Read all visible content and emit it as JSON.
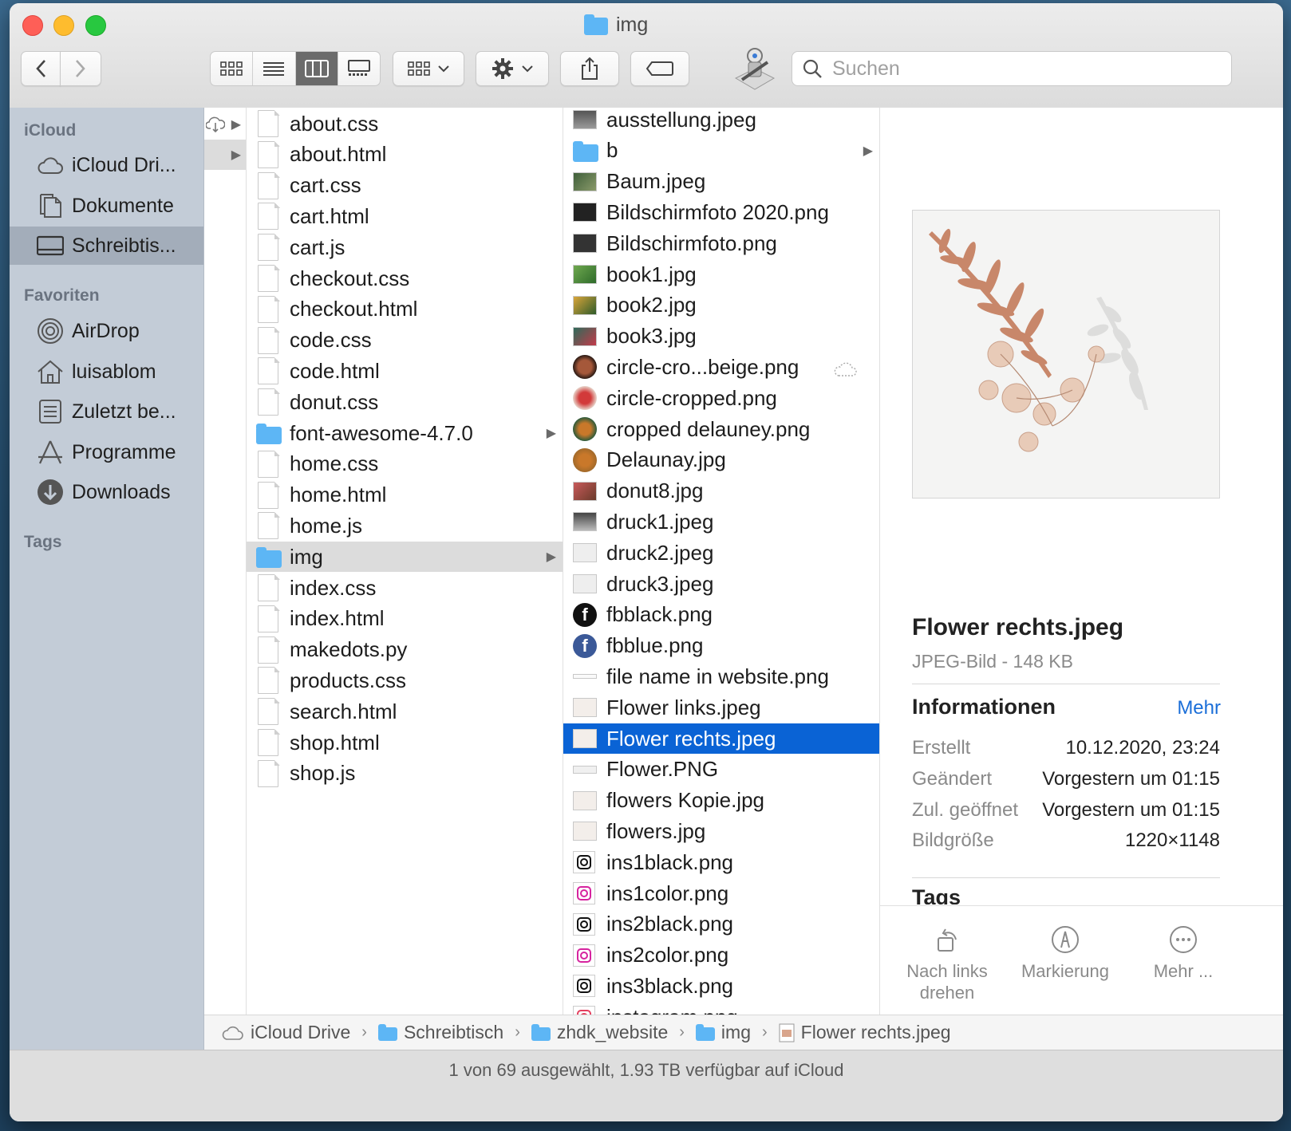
{
  "window": {
    "title": "img"
  },
  "toolbar": {
    "search_placeholder": "Suchen"
  },
  "sidebar": {
    "sections": [
      {
        "heading": "iCloud",
        "items": [
          {
            "label": "iCloud Dri...",
            "icon": "cloud-icon"
          },
          {
            "label": "Dokumente",
            "icon": "documents-icon"
          },
          {
            "label": "Schreibtis...",
            "icon": "desktop-icon",
            "selected": true
          }
        ]
      },
      {
        "heading": "Favoriten",
        "items": [
          {
            "label": "AirDrop",
            "icon": "airdrop-icon"
          },
          {
            "label": "luisablom",
            "icon": "home-icon"
          },
          {
            "label": "Zuletzt be...",
            "icon": "recents-icon"
          },
          {
            "label": "Programme",
            "icon": "applications-icon"
          },
          {
            "label": "Downloads",
            "icon": "downloads-icon"
          }
        ]
      },
      {
        "heading": "Tags",
        "items": []
      }
    ]
  },
  "column1": {
    "files": [
      "about.css",
      "about.html",
      "cart.css",
      "cart.html",
      "cart.js",
      "checkout.css",
      "checkout.html",
      "code.css",
      "code.html",
      "donut.css",
      "font-awesome-4.7.0",
      "home.css",
      "home.html",
      "home.js",
      "img",
      "index.css",
      "index.html",
      "makedots.py",
      "products.css",
      "search.html",
      "shop.html",
      "shop.js"
    ],
    "folders": [
      "font-awesome-4.7.0",
      "img"
    ],
    "selected": "img"
  },
  "column2": {
    "files": [
      "ausstellung.jpeg",
      "b",
      "Baum.jpeg",
      "Bildschirmfoto 2020.png",
      "Bildschirmfoto.png",
      "book1.jpg",
      "book2.jpg",
      "book3.jpg",
      "circle-cro...beige.png",
      "circle-cropped.png",
      "cropped delauney.png",
      "Delaunay.jpg",
      "donut8.jpg",
      "druck1.jpeg",
      "druck2.jpeg",
      "druck3.jpeg",
      "fbblack.png",
      "fbblue.png",
      "file name in website.png",
      "Flower links.jpeg",
      "Flower rechts.jpeg",
      "Flower.PNG",
      "flowers Kopie.jpg",
      "flowers.jpg",
      "ins1black.png",
      "ins1color.png",
      "ins2black.png",
      "ins2color.png",
      "ins3black.png",
      "instagram.png"
    ],
    "selected": "Flower rechts.jpeg"
  },
  "preview": {
    "name": "Flower rechts.jpeg",
    "kind": "JPEG-Bild - 148 KB",
    "info_heading": "Informationen",
    "more_link": "Mehr",
    "info": [
      {
        "key": "Erstellt",
        "value": "10.12.2020, 23:24"
      },
      {
        "key": "Geändert",
        "value": "Vorgestern um 01:15"
      },
      {
        "key": "Zul. geöffnet",
        "value": "Vorgestern um 01:15"
      },
      {
        "key": "Bildgröße",
        "value": "1220×1148"
      }
    ],
    "tags_heading": "Tags",
    "actions": [
      {
        "label": "Nach links drehen",
        "icon": "rotate-left-icon"
      },
      {
        "label": "Markierung",
        "icon": "markup-icon"
      },
      {
        "label": "Mehr ...",
        "icon": "more-icon"
      }
    ]
  },
  "pathbar": [
    "iCloud Drive",
    "Schreibtisch",
    "zhdk_website",
    "img",
    "Flower rechts.jpeg"
  ],
  "status": "1 von 69 ausgewählt, 1.93 TB verfügbar auf iCloud",
  "colors": {
    "selection": "#0a63d5",
    "folder": "#5db6f5",
    "link": "#1a6ed8"
  }
}
